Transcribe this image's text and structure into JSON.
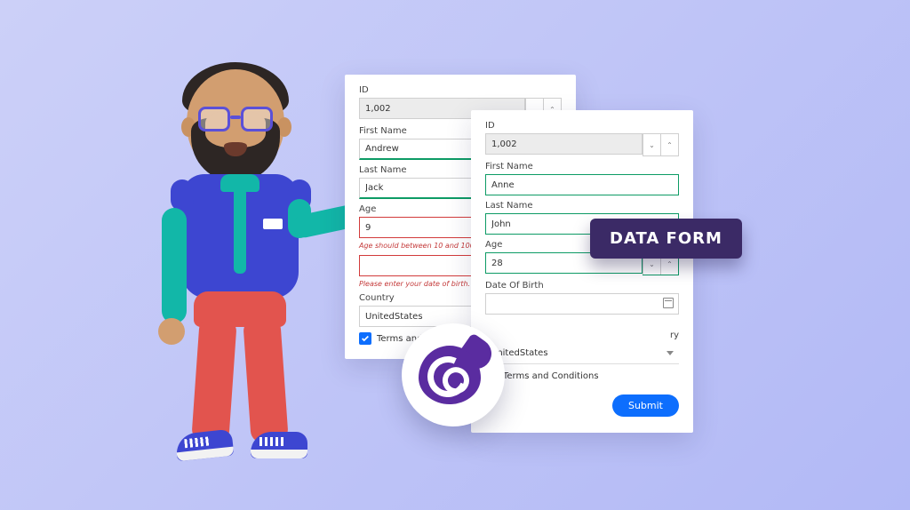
{
  "badge": "DATA FORM",
  "logo_name": "blazor-logo",
  "back": {
    "id_label": "ID",
    "id_value": "1,002",
    "first_label": "First Name",
    "first_value": "Andrew",
    "last_label": "Last Name",
    "last_value": "Jack",
    "age_label": "Age",
    "age_value": "9",
    "age_error": "Age should between 10 and 100",
    "dob_error": "Please enter your date of birth.",
    "country_label": "Country",
    "country_value": "UnitedStates",
    "terms_label": "Terms and Conditions",
    "terms_checked": true
  },
  "front": {
    "id_label": "ID",
    "id_value": "1,002",
    "first_label": "First Name",
    "first_value": "Anne",
    "last_label": "Last Name",
    "last_value": "John",
    "age_label": "Age",
    "age_value": "28",
    "dob_label": "Date Of Birth",
    "dob_value": "",
    "country_label_suffix": "ry",
    "country_value": "UnitedStates",
    "terms_label": "Terms and Conditions",
    "terms_checked": true,
    "submit": "Submit"
  }
}
